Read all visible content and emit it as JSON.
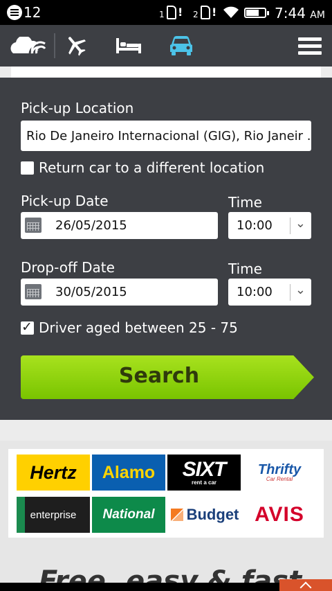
{
  "status_bar": {
    "notification_count": "12",
    "sim1": "1",
    "sim2": "2",
    "time": "7:44",
    "ampm": "AM"
  },
  "nav": {
    "items": [
      "logo",
      "flights",
      "hotels",
      "cars",
      "menu"
    ],
    "active": "cars",
    "active_color": "#4cc3e8"
  },
  "form": {
    "pickup_location_label": "Pick-up Location",
    "pickup_location_value": "Rio De Janeiro Internacional (GIG), Rio Janeir ...",
    "return_different_label": "Return car to a different location",
    "return_different_checked": false,
    "pickup_date_label": "Pick-up Date",
    "pickup_date_value": "26/05/2015",
    "pickup_time_label": "Time",
    "pickup_time_value": "10:00",
    "dropoff_date_label": "Drop-off Date",
    "dropoff_date_value": "30/05/2015",
    "dropoff_time_label": "Time",
    "dropoff_time_value": "10:00",
    "driver_age_label": "Driver aged between 25 - 75",
    "driver_age_checked": true,
    "search_label": "Search"
  },
  "brands": {
    "items": [
      "Hertz",
      "Alamo",
      "SIXT",
      "Thrifty",
      "enterprise",
      "National",
      "Budget",
      "AVIS"
    ],
    "sixt_sub": "rent a car",
    "thrifty_sub": "Car Rental"
  },
  "tagline": "Free, easy & fast"
}
